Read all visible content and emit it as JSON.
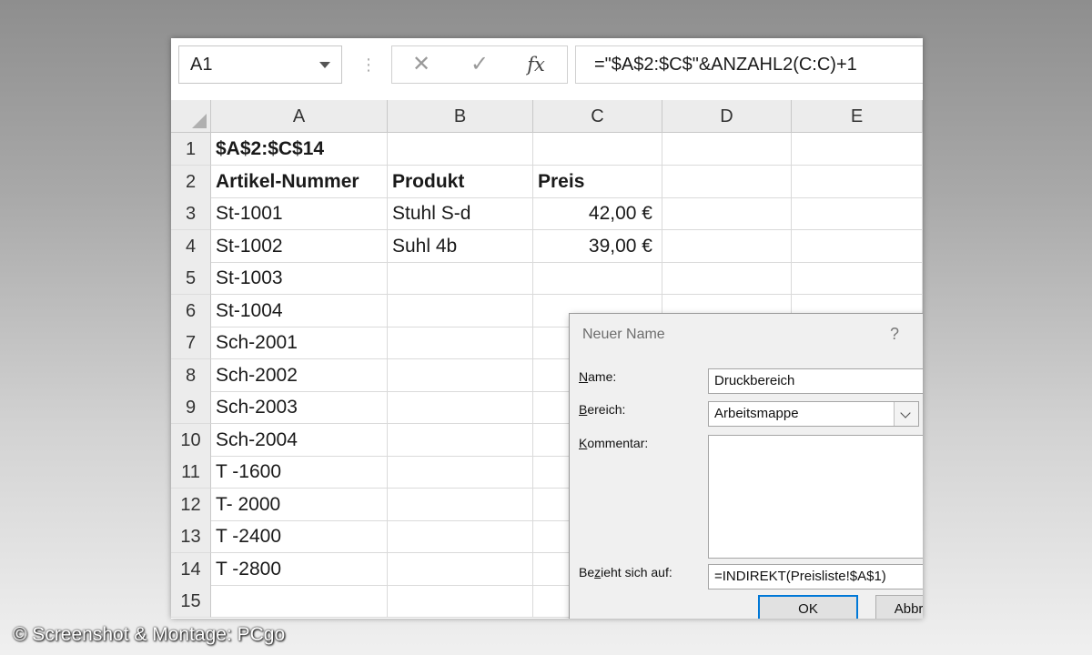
{
  "formula_bar": {
    "name_box": "A1",
    "cancel_icon": "✕",
    "enter_icon": "✓",
    "fx_icon": "fx",
    "formula": "=\"$A$2:$C$\"&ANZAHL2(C:C)+1"
  },
  "columns": [
    "A",
    "B",
    "C",
    "D",
    "E"
  ],
  "rows": [
    {
      "num": "1",
      "a": "$A$2:$C$14",
      "b": "",
      "c": ""
    },
    {
      "num": "2",
      "a": "Artikel-Nummer",
      "b": "Produkt",
      "c": "Preis"
    },
    {
      "num": "3",
      "a": "St-1001",
      "b": "Stuhl S-d",
      "c": "42,00 €"
    },
    {
      "num": "4",
      "a": "St-1002",
      "b": "Suhl 4b",
      "c": "39,00 €"
    },
    {
      "num": "5",
      "a": "St-1003",
      "b": "",
      "c": ""
    },
    {
      "num": "6",
      "a": "St-1004",
      "b": "",
      "c": ""
    },
    {
      "num": "7",
      "a": "Sch-2001",
      "b": "",
      "c": ""
    },
    {
      "num": "8",
      "a": "Sch-2002",
      "b": "",
      "c": ""
    },
    {
      "num": "9",
      "a": "Sch-2003",
      "b": "",
      "c": ""
    },
    {
      "num": "10",
      "a": "Sch-2004",
      "b": "",
      "c": ""
    },
    {
      "num": "11",
      "a": "T -1600",
      "b": "",
      "c": ""
    },
    {
      "num": "12",
      "a": "T- 2000",
      "b": "",
      "c": ""
    },
    {
      "num": "13",
      "a": "T -2400",
      "b": "",
      "c": ""
    },
    {
      "num": "14",
      "a": "T -2800",
      "b": "",
      "c": ""
    },
    {
      "num": "15",
      "a": "",
      "b": "",
      "c": ""
    }
  ],
  "dialog": {
    "title": "Neuer Name",
    "help": "?",
    "close": "✕",
    "name_label_key": "N",
    "name_label_rest": "ame:",
    "name_value": "Druckbereich",
    "scope_label_key": "B",
    "scope_label_rest": "ereich:",
    "scope_value": "Arbeitsmappe",
    "comment_label_key": "K",
    "comment_label_rest": "ommentar:",
    "refers_label_pre": "Be",
    "refers_label_key": "z",
    "refers_label_rest": "ieht sich auf:",
    "refers_value": "=INDIREKT(Preisliste!$A$1)",
    "ref_icon": "⭡",
    "ok": "OK",
    "cancel": "Abbrechen"
  },
  "watermark": "© Screenshot & Montage: PCgo"
}
